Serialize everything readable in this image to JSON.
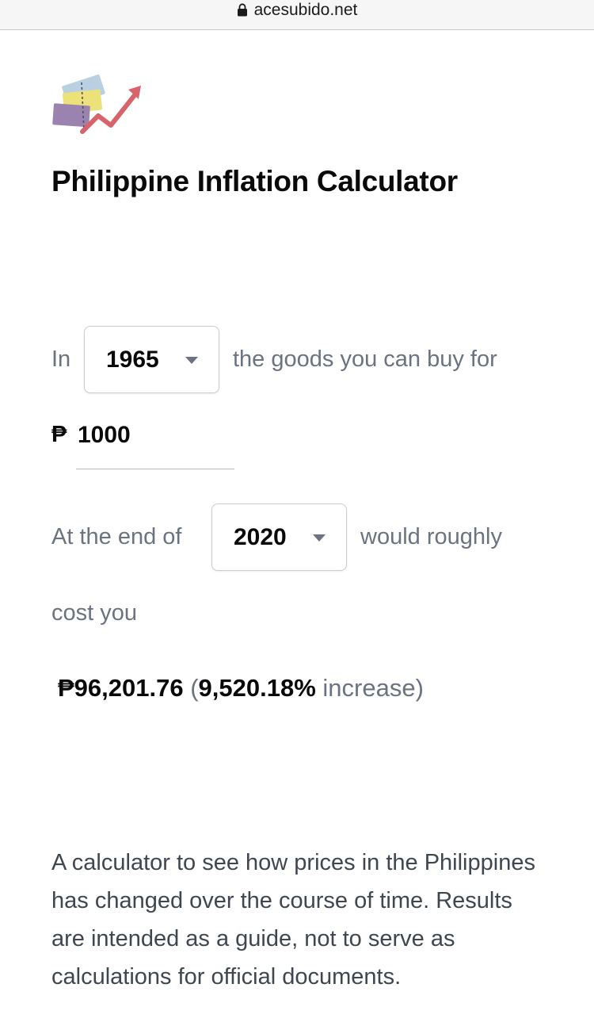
{
  "browser": {
    "url": "acesubido.net"
  },
  "page": {
    "title": "Philippine Inflation Calculator"
  },
  "calculator": {
    "in_label": "In",
    "start_year": "1965",
    "goods_label": "the goods you can buy for",
    "currency_symbol": "₱",
    "amount": "1000",
    "end_label": "At the end of",
    "end_year": "2020",
    "would_label": "would roughly",
    "cost_label": "cost you",
    "result_amount": "₱96,201.76",
    "result_open": "(",
    "result_percent": "9,520.18%",
    "result_increase_label": "increase)"
  },
  "description": "A calculator to see how prices in the Philippines has changed over the course of time. Results are intended as a guide, not to serve as calculations for official documents.",
  "colors": {
    "accent_red": "#d9636b",
    "muted_text": "#6b7280"
  },
  "icons": {
    "logo": "inflation-logo",
    "lock": "lock-icon",
    "caret": "caret-down-icon"
  }
}
